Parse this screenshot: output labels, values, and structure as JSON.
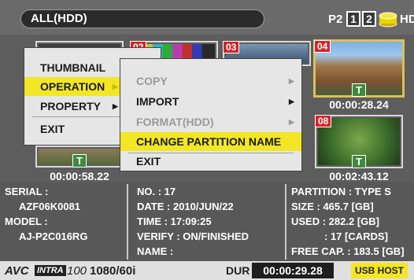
{
  "header": {
    "title": "ALL(HDD)",
    "p2_label": "P2",
    "slots": [
      "1",
      "2"
    ],
    "drive_label": "HDD"
  },
  "thumbnails": [
    {
      "clip": "02"
    },
    {
      "clip": "03"
    },
    {
      "clip": "04",
      "timecode": "00:00:28.24",
      "badge": "T"
    },
    {
      "clip": "08",
      "timecode": "00:02:43.12",
      "badge": "T"
    },
    {
      "timecode": "00:00:58.22",
      "badge": "T"
    }
  ],
  "main_menu": {
    "items": [
      {
        "label": "THUMBNAIL"
      },
      {
        "label": "OPERATION"
      },
      {
        "label": "PROPERTY"
      },
      {
        "label": "EXIT"
      }
    ]
  },
  "sub_menu": {
    "items": [
      {
        "label": "COPY",
        "enabled": false
      },
      {
        "label": "IMPORT",
        "enabled": true
      },
      {
        "label": "FORMAT(HDD)",
        "enabled": false
      },
      {
        "label": "CHANGE PARTITION NAME",
        "enabled": true,
        "selected": true
      },
      {
        "label": "EXIT",
        "enabled": true
      }
    ]
  },
  "info": {
    "col1": [
      "SERIAL :",
      "AZF06K0081",
      "MODEL :",
      "AJ-P2C016RG"
    ],
    "col2": [
      "NO. : 17",
      "DATE : 2010/JUN/22",
      "TIME : 17:09:25",
      "VERIFY : ON/FINISHED",
      "NAME :"
    ],
    "col3": [
      "PARTITION : TYPE S",
      "SIZE : 465.7 [GB]",
      "USED : 282.2 [GB]",
      ": 17 [CARDS]",
      "FREE CAP. : 183.5 [GB]"
    ]
  },
  "status_bar": {
    "codec_prefix": "AVC",
    "codec_badge": "INTRA",
    "codec_rate": "100",
    "format": "1080/60i",
    "dur_label": "DUR",
    "duration": "00:00:29.28",
    "usb_host": "USB HOST"
  },
  "colors": {
    "highlight": "#f3e625",
    "clip_number": "#d4242a",
    "thumb_badge": "#3e8a3e"
  }
}
